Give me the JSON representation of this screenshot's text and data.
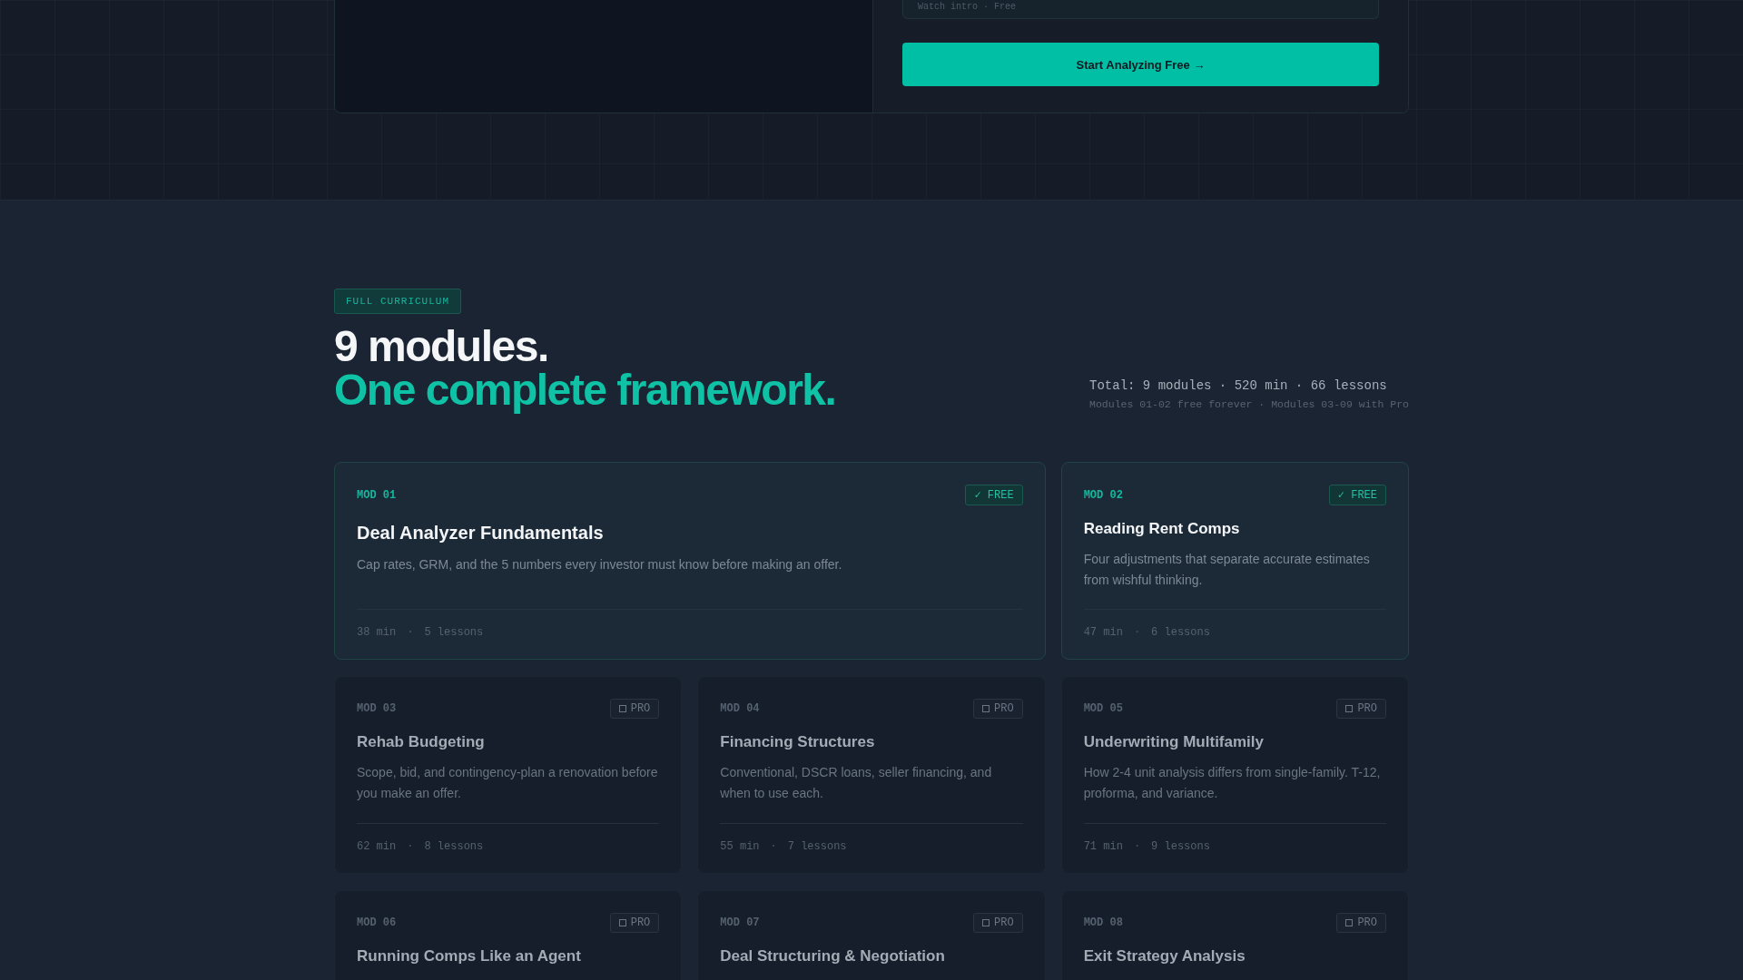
{
  "hero": {
    "field_value": "Watch intro · Free",
    "cta": "Start Analyzing Free →"
  },
  "section": {
    "eyebrow": "FULL CURRICULUM",
    "title": "9 modules.",
    "title_accent": "One complete framework.",
    "totals": "Total: 9 modules · 520 min · 66 lessons",
    "note": "Modules 01-02 free forever · Modules 03-09 with Pro"
  },
  "modules": [
    {
      "kind": "free",
      "code": "MOD 01",
      "badge": "✓ FREE",
      "title": "Deal Analyzer Fundamentals",
      "description": "Cap rates, GRM, and the 5 numbers every investor must know before making an offer.",
      "duration": "38 min",
      "separator": "·",
      "lessons": "5 lessons",
      "wide": true
    },
    {
      "kind": "free",
      "code": "MOD 02",
      "badge": "✓ FREE",
      "title": "Reading Rent Comps",
      "description": "Four adjustments that separate accurate estimates from wishful thinking.",
      "duration": "47 min",
      "separator": "·",
      "lessons": "6 lessons",
      "wide": false
    },
    {
      "kind": "pro",
      "code": "MOD 03",
      "badge": "PRO",
      "title": "Rehab Budgeting",
      "description": "Scope, bid, and contingency-plan a renovation before you make an offer.",
      "duration": "62 min",
      "separator": "·",
      "lessons": "8 lessons",
      "wide": false
    },
    {
      "kind": "pro",
      "code": "MOD 04",
      "badge": "PRO",
      "title": "Financing Structures",
      "description": "Conventional, DSCR loans, seller financing, and when to use each.",
      "duration": "55 min",
      "separator": "·",
      "lessons": "7 lessons",
      "wide": false
    },
    {
      "kind": "pro",
      "code": "MOD 05",
      "badge": "PRO",
      "title": "Underwriting Multifamily",
      "description": "How 2-4 unit analysis differs from single-family. T-12, proforma, and variance.",
      "duration": "71 min",
      "separator": "·",
      "lessons": "9 lessons",
      "wide": false
    },
    {
      "kind": "pro",
      "code": "MOD 06",
      "badge": "PRO",
      "title": "Running Comps Like an Agent",
      "wide": false
    },
    {
      "kind": "pro",
      "code": "MOD 07",
      "badge": "PRO",
      "title": "Deal Structuring & Negotiation",
      "wide": false
    },
    {
      "kind": "pro",
      "code": "MOD 08",
      "badge": "PRO",
      "title": "Exit Strategy Analysis",
      "wide": false
    }
  ]
}
